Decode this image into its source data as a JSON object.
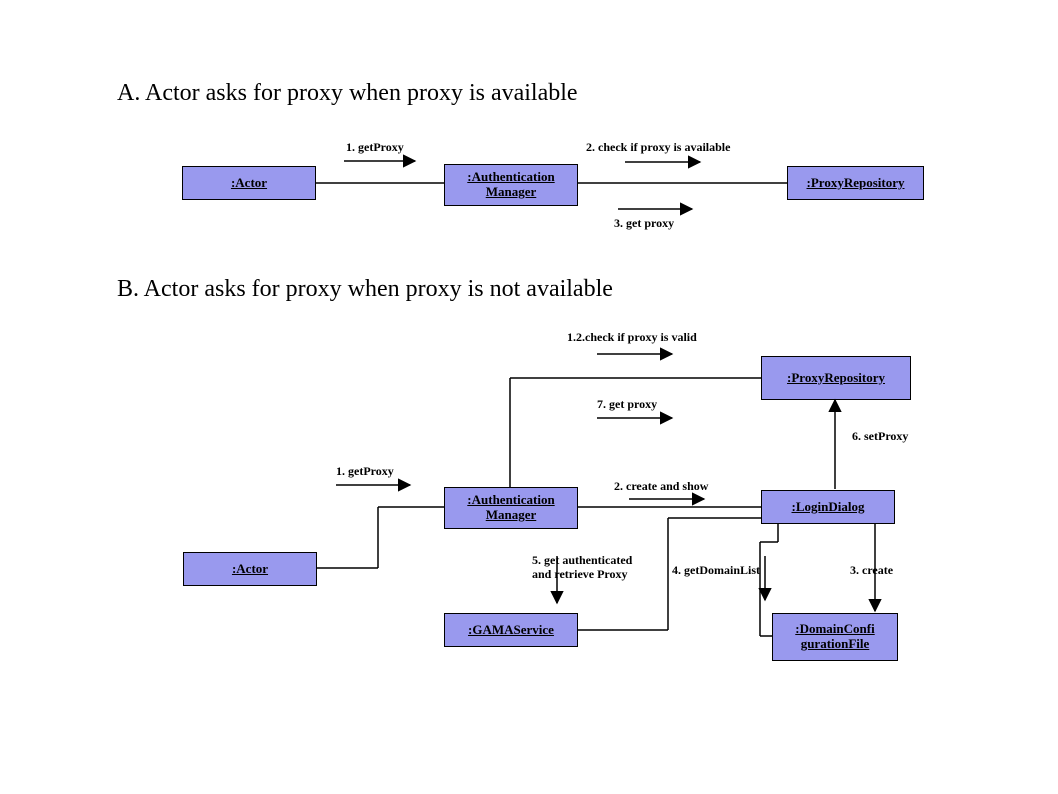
{
  "sections": {
    "A": {
      "title": "A. Actor asks for proxy when proxy is available",
      "nodes": {
        "actor": ":Actor",
        "auth": ":Authentication\nManager",
        "proxy": ":ProxyRepository"
      },
      "messages": {
        "m1": "1. getProxy",
        "m2": "2. check if proxy is available",
        "m3": "3. get proxy"
      }
    },
    "B": {
      "title": "B. Actor asks for proxy when proxy is not available",
      "nodes": {
        "actor": ":Actor",
        "auth": ":Authentication\nManager",
        "proxy": ":ProxyRepository",
        "login": ":LoginDialog",
        "gama": ":GAMAService",
        "domain": ":DomainConfi\ngurationFile"
      },
      "messages": {
        "m1": "1. getProxy",
        "m1_2": "1.2.check if proxy is valid",
        "m2": "2. create and show",
        "m3": "3. create",
        "m4": "4. getDomainList",
        "m5": "5. get authenticated\nand retrieve Proxy",
        "m6": "6. setProxy",
        "m7": "7. get proxy"
      }
    }
  }
}
